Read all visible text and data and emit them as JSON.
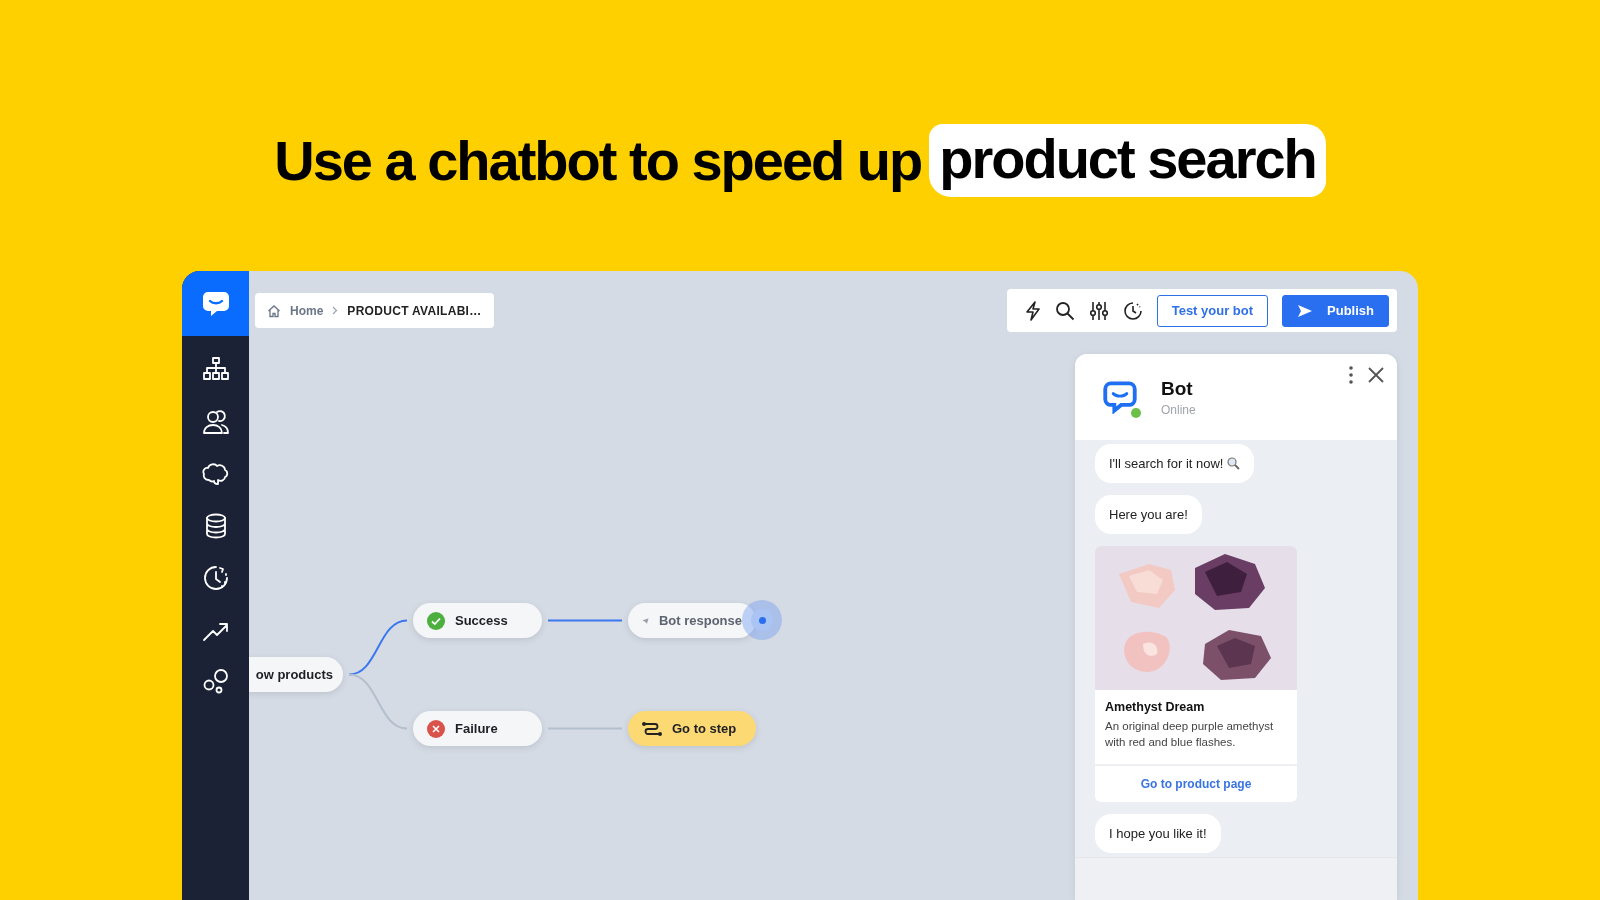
{
  "headline": {
    "text": "Use a chatbot to speed up",
    "highlight": "product search"
  },
  "breadcrumb": [
    "Home",
    "PRODUCT AVAILABI…"
  ],
  "toolbar": {
    "buttons": [
      {
        "label": "Test your bot",
        "kind": "outline"
      },
      {
        "label": "Publish",
        "kind": "primary"
      }
    ]
  },
  "flow": {
    "nodes": [
      {
        "label": "ow products",
        "kind": "block"
      },
      {
        "label": "Success",
        "kind": "success"
      },
      {
        "label": "Failure",
        "kind": "failure"
      },
      {
        "label": "Bot response",
        "kind": "response"
      },
      {
        "label": "Go to step",
        "kind": "goto"
      }
    ],
    "links": [
      {
        "active": true
      },
      {
        "active": false
      },
      {
        "active": true
      },
      {
        "active": false
      }
    ]
  },
  "chat": {
    "title": "Bot",
    "status": "Online",
    "online": true,
    "messages": [
      {
        "kind": "text",
        "text": "I'll search for it now!",
        "search_icon": true
      },
      {
        "kind": "text",
        "text": "Here you are!"
      },
      {
        "kind": "card",
        "title": "Amethyst Dream",
        "description": "An original deep purple amethyst with red and blue flashes.",
        "link": "Go to product page"
      },
      {
        "kind": "text",
        "text": "I hope you like it!"
      }
    ]
  }
}
